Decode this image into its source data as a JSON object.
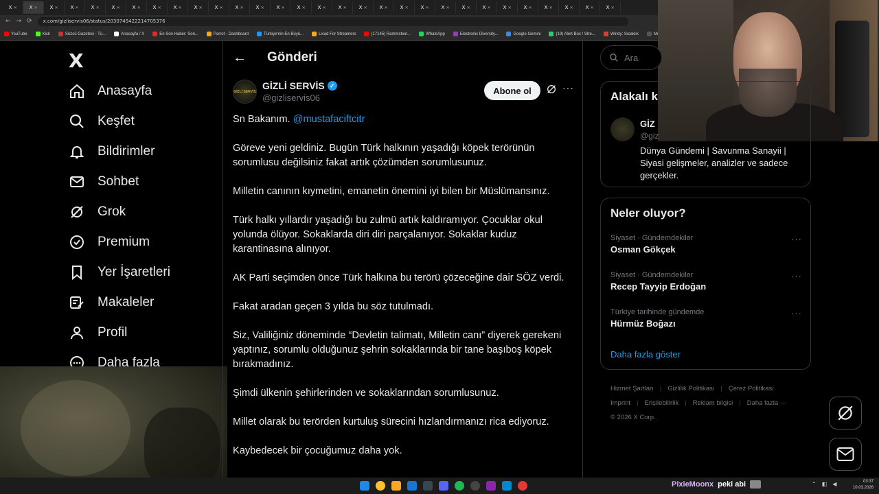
{
  "browser": {
    "tabs": [
      "x",
      "x",
      "x",
      "x",
      "x",
      "x",
      "x",
      "x",
      "x",
      "x",
      "x",
      "x",
      "x",
      "x",
      "x",
      "x",
      "x",
      "x",
      "x",
      "x",
      "x",
      "x",
      "x",
      "x",
      "x",
      "x",
      "x",
      "x",
      "x",
      "x"
    ],
    "url": "x.com/gizliservis06/status/2030745422214705376",
    "bookmarks": [
      {
        "label": "YouTube",
        "color": "#ff0000"
      },
      {
        "label": "Kick",
        "color": "#53fc18"
      },
      {
        "label": "Sözcü Gazetesi - Tü...",
        "color": "#d32f2f"
      },
      {
        "label": "Anasayfa / X",
        "color": "#ffffff"
      },
      {
        "label": "En Son Haber: Son...",
        "color": "#d32f2f"
      },
      {
        "label": "Parrot - Dashboard",
        "color": "#f5a623"
      },
      {
        "label": "Türkiye'nin En Büyü...",
        "color": "#2196f3"
      },
      {
        "label": "Livad For Streamers",
        "color": "#f5a623"
      },
      {
        "label": "(17145) Rammstein...",
        "color": "#ff0000"
      },
      {
        "label": "WhatsApp",
        "color": "#25d366"
      },
      {
        "label": "Electronic Diversity...",
        "color": "#8e44ad"
      },
      {
        "label": "Google Gemini",
        "color": "#4285f4"
      },
      {
        "label": "(19) Alert Box / Stre...",
        "color": "#2ecc71"
      },
      {
        "label": "Windy: Sıcaklık",
        "color": "#e53935"
      },
      {
        "label": "Multi TV - 6 haber",
        "color": "#555555"
      }
    ]
  },
  "nav": {
    "logo": "X",
    "items": [
      {
        "label": "Anasayfa",
        "icon": "home-icon"
      },
      {
        "label": "Keşfet",
        "icon": "search-icon"
      },
      {
        "label": "Bildirimler",
        "icon": "bell-icon"
      },
      {
        "label": "Sohbet",
        "icon": "mail-icon"
      },
      {
        "label": "Grok",
        "icon": "grok-icon"
      },
      {
        "label": "Premium",
        "icon": "premium-icon"
      },
      {
        "label": "Yer İşaretleri",
        "icon": "bookmark-icon"
      },
      {
        "label": "Makaleler",
        "icon": "articles-icon"
      },
      {
        "label": "Profil",
        "icon": "profile-icon"
      },
      {
        "label": "Daha fazla",
        "icon": "more-icon"
      }
    ]
  },
  "header": {
    "title": "Gönderi"
  },
  "post": {
    "author_name": "GİZLİ SERVİS",
    "author_handle": "@gizliservis06",
    "avatar_text": "GİZLİ SERVİS",
    "follow_label": "Abone ol",
    "mention": "@mustafaciftcitr",
    "greeting": "Sn Bakanım.",
    "paragraphs": [
      "Göreve yeni geldiniz. Bugün Türk halkının yaşadığı köpek terörünün sorumlusu değilsiniz fakat artık çözümden sorumlusunuz.",
      "Milletin canının kıymetini, emanetin önemini iyi bilen bir Müslümansınız.",
      "Türk halkı yıllardır yaşadığı bu zulmü artık kaldıramıyor. Çocuklar okul yolunda ölüyor. Sokaklarda diri diri parçalanıyor. Sokaklar kuduz karantinasına alınıyor.",
      "AK Parti seçimden önce Türk halkına bu terörü çözeceğine dair SÖZ verdi.",
      "Fakat aradan geçen 3 yılda bu söz tutulmadı.",
      "Siz, Valiliğiniz döneminde “Devletin talimatı, Milletin canı” diyerek gerekeni yaptınız, sorumlu olduğunuz şehrin sokaklarında bir tane başıboş köpek bırakmadınız.",
      "Şimdi ülkenin şehirlerinden ve sokaklarından sorumlusunuz.",
      "Millet olarak bu terörden kurtuluş sürecini hızlandırmanızı rica ediyoruz.",
      "Kaybedecek bir çocuğumuz daha yok."
    ]
  },
  "sidebar": {
    "search_placeholder": "Ara",
    "related": {
      "heading": "Alakalı k",
      "name": "GİZ",
      "handle": "@giz",
      "bio": "Dünya Gündemi | Savunma Sanayii | Siyasi gelişmeler, analizler ve sadece gerçekler."
    },
    "trends": {
      "heading": "Neler oluyor?",
      "items": [
        {
          "context": "Siyaset · Gündemdekiler",
          "title": "Osman Gökçek"
        },
        {
          "context": "Siyaset · Gündemdekiler",
          "title": "Recep Tayyip Erdoğan"
        },
        {
          "context": "Türkiye tarihinde gündemde",
          "title": "Hürmüz Boğazı"
        }
      ],
      "show_more": "Daha fazla göster"
    },
    "footer": {
      "links": [
        "Hizmet Şartları",
        "Gizlilik Politikası",
        "Çerez Politikası",
        "Imprint",
        "Erişilebilirlik",
        "Reklam bilgisi",
        "Daha fazla ···"
      ],
      "copyright": "© 2026 X Corp."
    }
  },
  "taskbar": {
    "chat_user": "PixieMoonx",
    "chat_message": "peki abi",
    "time": "03:37",
    "date": "10.03.2026"
  }
}
